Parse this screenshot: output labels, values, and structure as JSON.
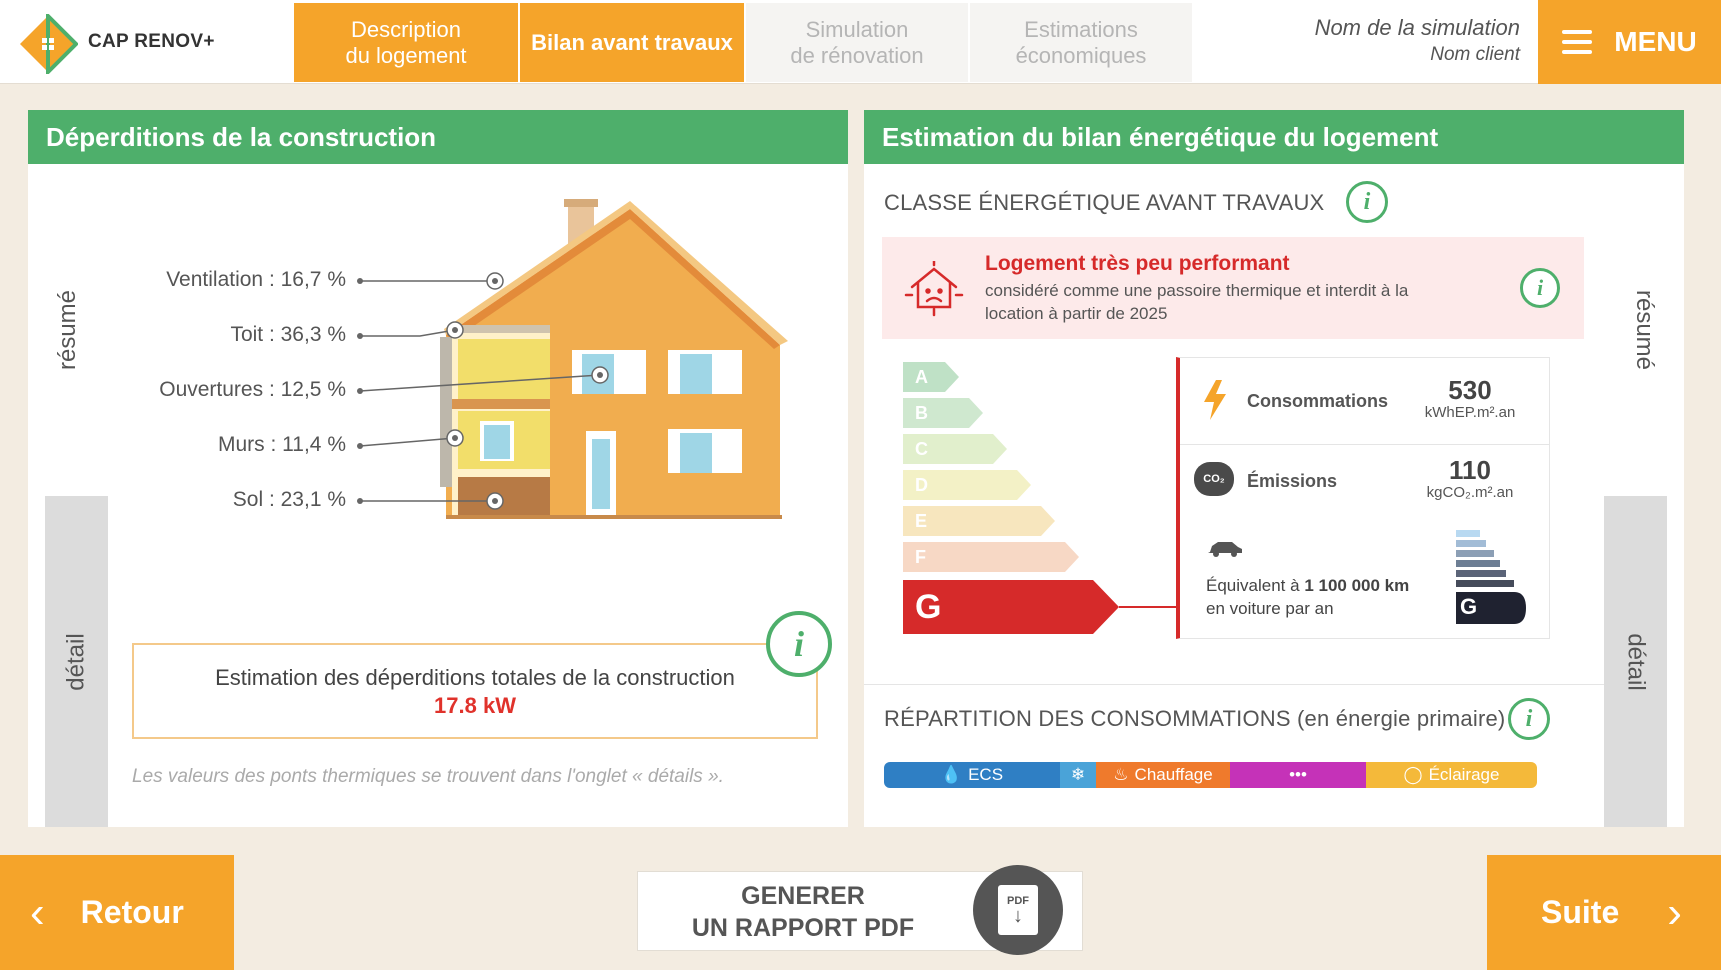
{
  "app": {
    "name": "CAP RENOV+"
  },
  "tabs": [
    {
      "line1": "Description",
      "line2": "du logement",
      "state": "done"
    },
    {
      "line1": "Bilan avant travaux",
      "line2": "",
      "state": "active"
    },
    {
      "line1": "Simulation",
      "line2": "de rénovation",
      "state": "todo"
    },
    {
      "line1": "Estimations",
      "line2": "économiques",
      "state": "todo"
    }
  ],
  "simulation": {
    "name": "Nom de la simulation",
    "client": "Nom client"
  },
  "menu_label": "MENU",
  "left_panel": {
    "title": "Déperditions de la construction",
    "tab_resume": "résumé",
    "tab_detail": "détail",
    "losses": [
      {
        "label": "Ventilation : 16,7 %"
      },
      {
        "label": "Toit : 36,3 %"
      },
      {
        "label": "Ouvertures : 12,5 %"
      },
      {
        "label": "Murs : 11,4 %"
      },
      {
        "label": "Sol : 23,1 %"
      }
    ],
    "total_text": "Estimation des déperditions totales de la construction",
    "total_value": "17.8 kW",
    "note": "Les valeurs des ponts thermiques se trouvent dans l'onglet « détails »."
  },
  "right_panel": {
    "title": "Estimation du bilan énergétique du logement",
    "tab_resume": "résumé",
    "tab_detail": "détail",
    "class_section_title": "CLASSE ÉNERGÉTIQUE AVANT TRAVAUX",
    "alert_title": "Logement très peu performant",
    "alert_text": "considéré comme une passoire thermique et interdit à la location à partir de 2025",
    "energy_classes": [
      "A",
      "B",
      "C",
      "D",
      "E",
      "F",
      "G"
    ],
    "current_class": "G",
    "consumption": {
      "label": "Consommations",
      "value": "530",
      "unit": "kWhEP.m².an"
    },
    "emissions": {
      "label": "Émissions",
      "value": "110",
      "unit": "kgCO₂.m².an",
      "icon_text": "CO₂"
    },
    "car_equivalent_prefix": "Équivalent à",
    "car_equivalent_value": "1 100 000 km",
    "car_equivalent_suffix": "en voiture par an",
    "ges_class": "G",
    "repartition_title": "RÉPARTITION DES CONSOMMATIONS (en énergie primaire)",
    "repartition": [
      {
        "label": "ECS",
        "icon": "drop-icon",
        "color": "#2f7fc4"
      },
      {
        "label": "",
        "icon": "snowflake-icon",
        "color": "#4aa3d8"
      },
      {
        "label": "Chauffage",
        "icon": "flame-icon",
        "color": "#ef7a2c"
      },
      {
        "label": "•••",
        "icon": "more-icon",
        "color": "#c532b8"
      },
      {
        "label": "Éclairage",
        "icon": "bulb-icon",
        "color": "#f4b93a"
      }
    ]
  },
  "footer": {
    "back_label": "Retour",
    "next_label": "Suite",
    "pdf_line1": "GENERER",
    "pdf_line2": "UN RAPPORT PDF",
    "pdf_icon_text": "PDF"
  },
  "colors": {
    "accent": "#f5a42a",
    "green": "#4eaf6b",
    "red": "#d62a2a"
  }
}
